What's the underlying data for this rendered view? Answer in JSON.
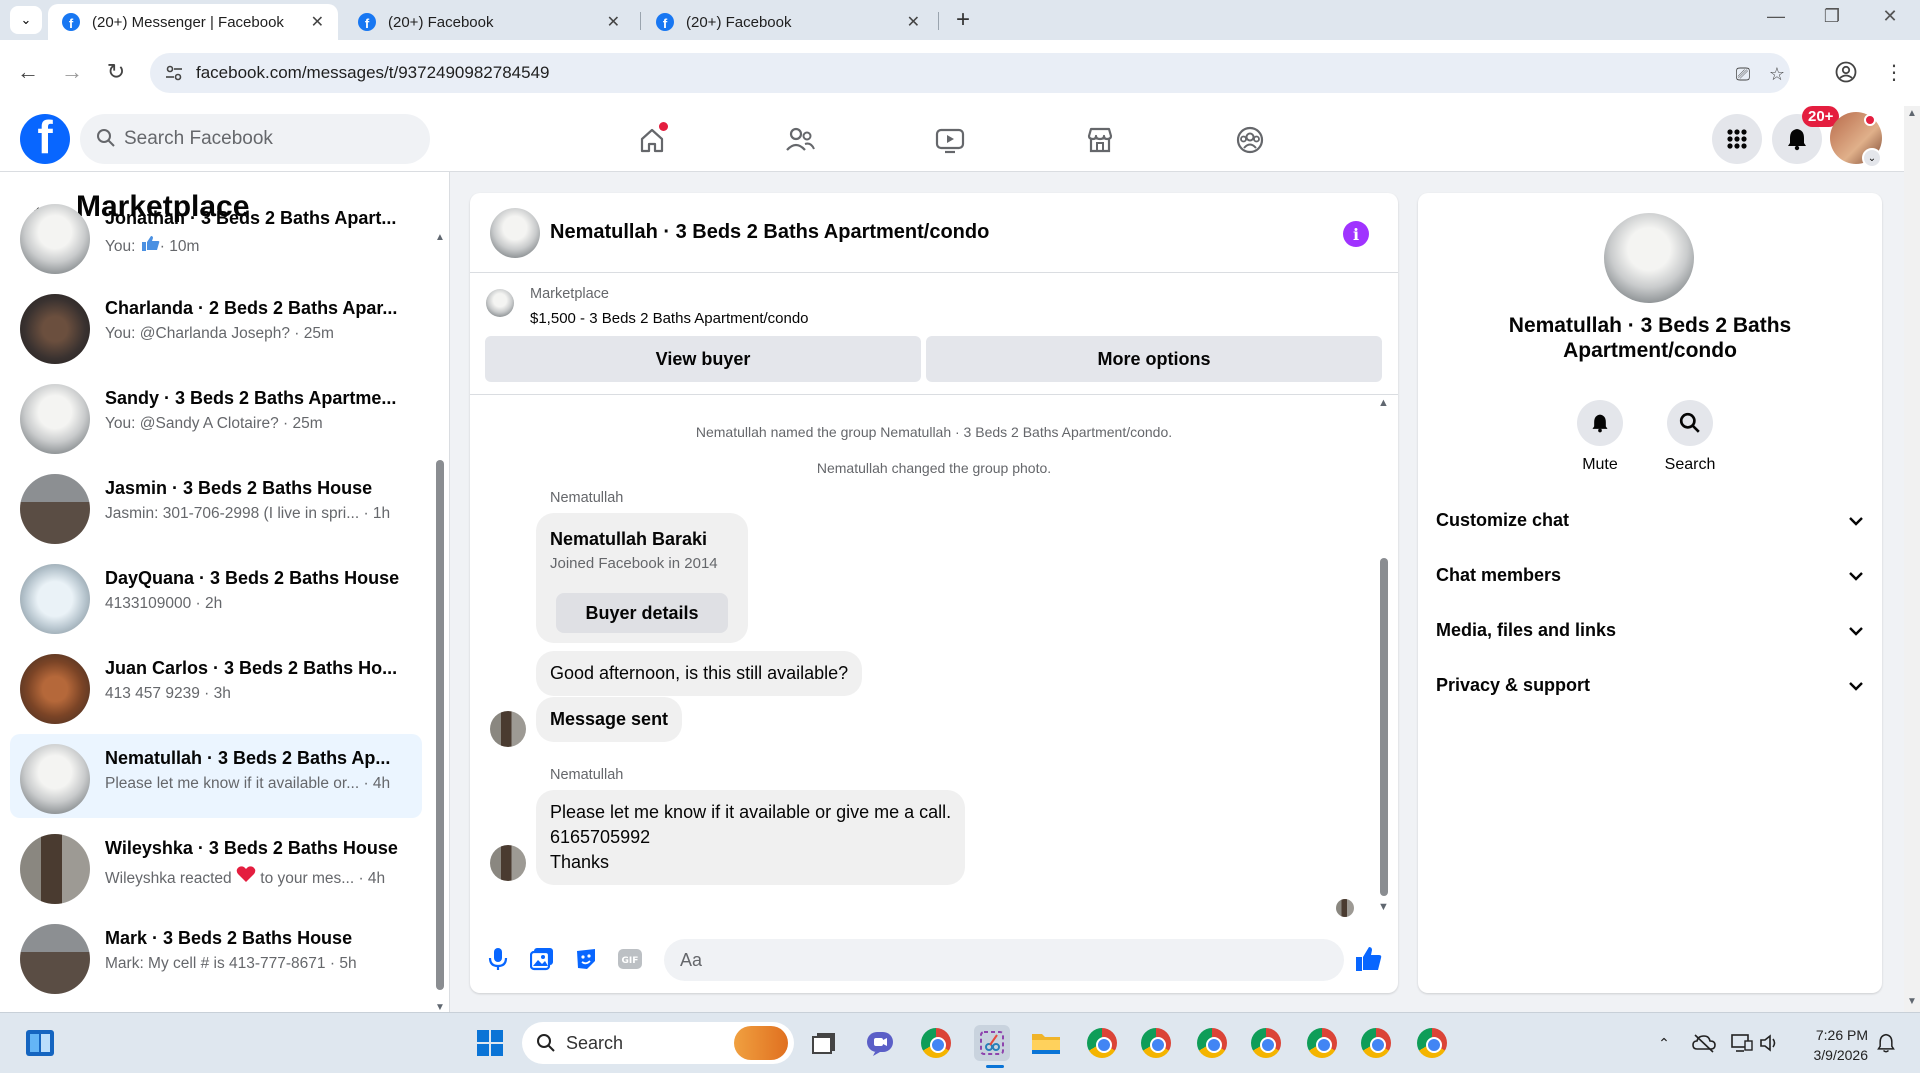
{
  "browser": {
    "tabs": [
      {
        "title": "(20+) Messenger | Facebook",
        "active": true
      },
      {
        "title": "(20+) Facebook",
        "active": false
      },
      {
        "title": "(20+) Facebook",
        "active": false
      }
    ],
    "url": "facebook.com/messages/t/9372490982784549"
  },
  "fb_header": {
    "search_placeholder": "Search Facebook",
    "notification_badge": "20+",
    "nav_icons": [
      "home-icon",
      "friends-icon",
      "video-icon",
      "marketplace-icon",
      "groups-icon"
    ]
  },
  "left_panel": {
    "title": "Marketplace",
    "conversations": [
      {
        "name": "Jonathan · 3 Beds 2 Baths Apart...",
        "preview": "You: ",
        "time": "· 10m",
        "thumb": "kitchen"
      },
      {
        "name": "Charlanda · 2 Beds 2 Baths Apar...",
        "preview": "You: @Charlanda Joseph?",
        "time": " · 25m",
        "thumb": "darkkitchen"
      },
      {
        "name": "Sandy · 3 Beds 2 Baths Apartme...",
        "preview": "You: @Sandy A Clotaire?",
        "time": " · 25m",
        "thumb": "kitchen"
      },
      {
        "name": "Jasmin · 3 Beds 2 Baths House",
        "preview": "Jasmin: 301-706-2998 (I live in spri...",
        "time": " · 1h",
        "thumb": "room"
      },
      {
        "name": "DayQuana · 3 Beds 2 Baths House",
        "preview": "4133109000",
        "time": " · 2h",
        "thumb": "bright"
      },
      {
        "name": "Juan Carlos · 3 Beds 2 Baths Ho...",
        "preview": "413 457 9239",
        "time": " · 3h",
        "thumb": "wood"
      },
      {
        "name": "Nematullah · 3 Beds 2 Baths Ap...",
        "preview": "Please let me know if it available or...",
        "time": " · 4h",
        "thumb": "kitchen",
        "selected": true
      },
      {
        "name": "Wileyshka · 3 Beds 2 Baths House",
        "preview": "Wileyshka reacted ",
        "preview2": " to your mes...",
        "time": " · 4h",
        "thumb": "door"
      },
      {
        "name": "Mark · 3 Beds 2 Baths House",
        "preview": "Mark: My cell # is 413-777-8671",
        "time": " · 5h",
        "thumb": "room"
      }
    ]
  },
  "chat": {
    "title": "Nematullah · 3 Beds 2 Baths Apartment/condo",
    "listing_label": "Marketplace",
    "listing_price": "$1,500 - 3 Beds 2 Baths Apartment/condo",
    "view_buyer": "View buyer",
    "more_options": "More options",
    "system_messages": [
      "Nematullah named the group Nematullah · 3 Beds 2 Baths Apartment/condo.",
      "Nematullah changed the group photo."
    ],
    "sender_name": "Nematullah",
    "buyer_card": {
      "name": "Nematullah Baraki",
      "joined": "Joined Facebook in 2014",
      "button": "Buyer details"
    },
    "messages": [
      "Good afternoon, is this still available?",
      "Message sent"
    ],
    "last_message_lines": [
      "Please let me know if it available or give me a call.",
      "6165705992",
      "Thanks"
    ],
    "composer_placeholder": "Aa"
  },
  "right_panel": {
    "name": "Nematullah · 3 Beds 2 Baths Apartment/condo",
    "actions": [
      "Mute",
      "Search"
    ],
    "sections": [
      "Customize chat",
      "Chat members",
      "Media, files and links",
      "Privacy & support"
    ]
  },
  "taskbar": {
    "search_label": "Search",
    "time": "7:26 PM",
    "date": "3/9/2026"
  },
  "colors": {
    "fb_blue": "#0866ff",
    "selected_row": "#ebf5ff",
    "info_purple": "#a033ff",
    "badge_red": "#e41e3f"
  }
}
